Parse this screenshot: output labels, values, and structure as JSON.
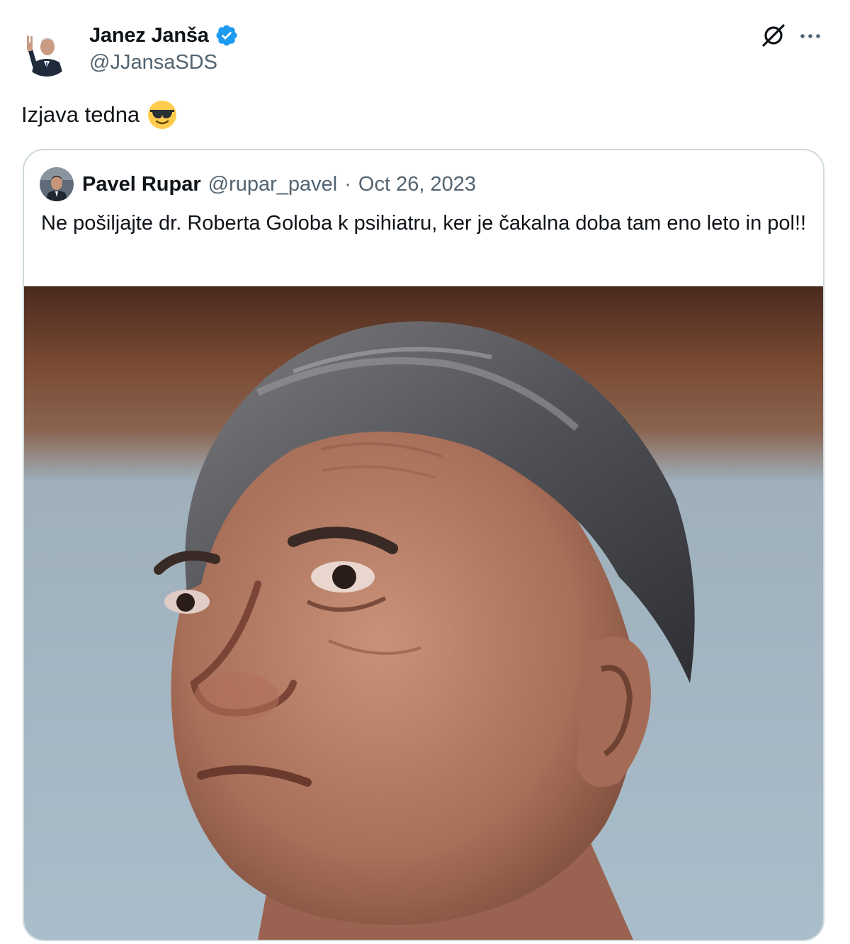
{
  "tweet": {
    "author_name": "Janez Janša",
    "author_handle": "@JJansaSDS",
    "verified_badge_icon": "verified-check-icon",
    "grok_icon": "grok-icon",
    "more_icon": "more-dots-icon",
    "text": "Izjava tedna",
    "emoji": "smiling-face-with-sunglasses-icon",
    "accent_color": "#1d9bf0",
    "secondary_text_color": "#536471"
  },
  "quote": {
    "author_name": "Pavel Rupar",
    "author_handle": "@rupar_pavel",
    "separator": "·",
    "date": "Oct 26, 2023",
    "text": "Ne pošiljajte dr. Roberta Goloba k psihiatru, ker je čakalna doba tam eno leto in pol!!"
  }
}
